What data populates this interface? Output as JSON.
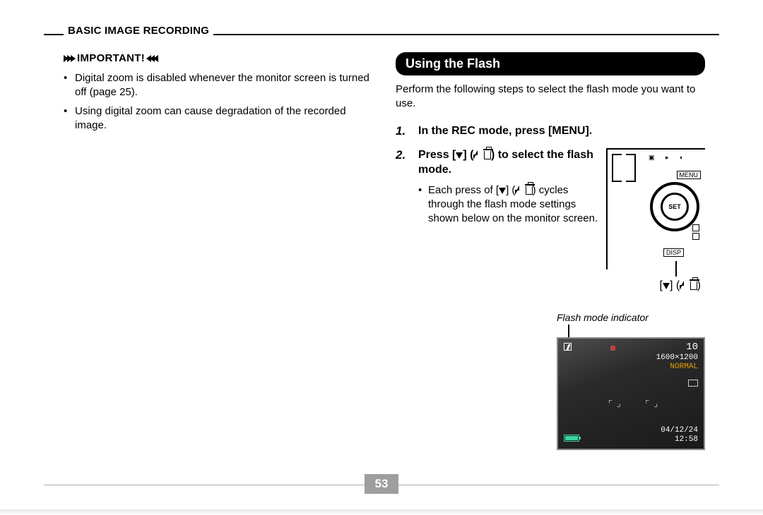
{
  "header": {
    "title": "BASIC IMAGE RECORDING"
  },
  "left": {
    "important_label": "IMPORTANT!",
    "bullets": [
      "Digital zoom is disabled whenever the monitor screen is turned off (page 25).",
      "Using digital zoom can cause degradation of the recorded image."
    ]
  },
  "right": {
    "section_title": "Using the Flash",
    "intro": "Perform the following steps to select the flash mode you want to use.",
    "step1_num": "1.",
    "step1_title": "In the REC mode, press [MENU].",
    "step2_num": "2.",
    "step2_title_a": "Press [",
    "step2_title_b": "] (",
    "step2_title_c": ") to select the flash mode.",
    "step2_bullet_a": "Each press of [",
    "step2_bullet_b": "] (",
    "step2_bullet_c": ") cycles through the flash mode settings shown below on the monitor screen.",
    "diagram": {
      "menu": "MENU",
      "set": "SET",
      "disp": "DISP"
    },
    "bracket_label_a": "[",
    "bracket_label_b": "] (",
    "bracket_label_c": ")",
    "flash_caption": "Flash mode indicator",
    "lcd": {
      "shots": "10",
      "resolution": "1600×1200",
      "quality": "NORMAL",
      "date": "04/12/24",
      "time": "12:58"
    }
  },
  "page_number": "53"
}
